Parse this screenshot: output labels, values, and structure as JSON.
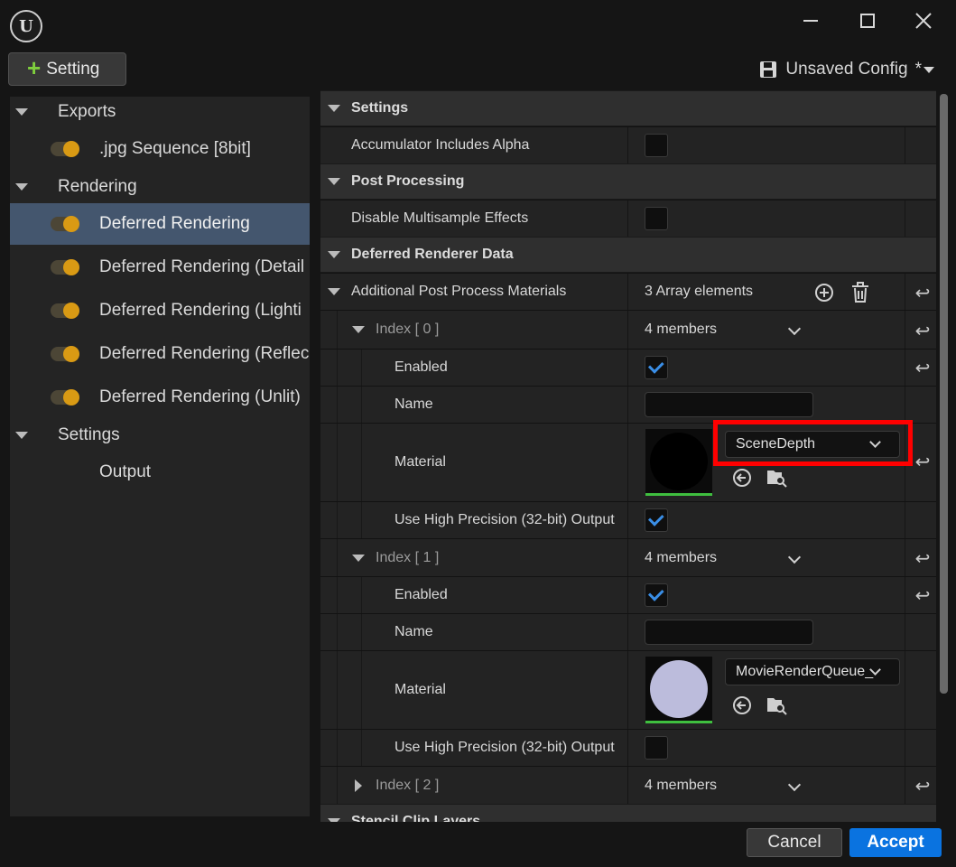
{
  "window": {
    "logo_text": "U",
    "minimize_glyph": "—",
    "maximize_glyph": "☐",
    "close_glyph": "✕"
  },
  "toolbar": {
    "add_setting_label": "Setting",
    "config_label": "Unsaved Config",
    "config_modified_marker": "*",
    "save_icon": "save-icon"
  },
  "tree": {
    "exports_label": "Exports",
    "jpg_label": ".jpg Sequence [8bit]",
    "rendering_label": "Rendering",
    "deferred_label": "Deferred Rendering",
    "deferred_detail_label": "Deferred Rendering (Detail",
    "deferred_lighting_label": "Deferred Rendering (Lighti",
    "deferred_reflections_label": "Deferred Rendering (Reflec",
    "deferred_unlit_label": "Deferred Rendering (Unlit)",
    "settings_label": "Settings",
    "output_label": "Output"
  },
  "details": {
    "cat_settings": "Settings",
    "accumulator_label": "Accumulator Includes Alpha",
    "cat_post": "Post Processing",
    "disable_msaa_label": "Disable Multisample Effects",
    "cat_deferred": "Deferred Renderer Data",
    "additional_label": "Additional Post Process Materials",
    "array_count": "3 Array elements",
    "index0_label": "Index [ 0 ]",
    "index0_members": "4 members",
    "enabled_label": "Enabled",
    "name_label": "Name",
    "material_label": "Material",
    "material0_value": "SceneDepth",
    "high_precision_label": "Use High Precision (32-bit) Output",
    "index1_label": "Index [ 1 ]",
    "index1_members": "4 members",
    "material1_value": "MovieRenderQueue_",
    "index2_label": "Index [ 2 ]",
    "index2_members": "4 members",
    "cat_stencil": "Stencil Clip Layers"
  },
  "footer": {
    "cancel_label": "Cancel",
    "accept_label": "Accept"
  },
  "colors": {
    "accent": "#0a73e0",
    "toggle_on": "#d99a14",
    "highlight": "#ff0000",
    "selection": "#44566e",
    "material1_disc": "#bcbcdc"
  }
}
